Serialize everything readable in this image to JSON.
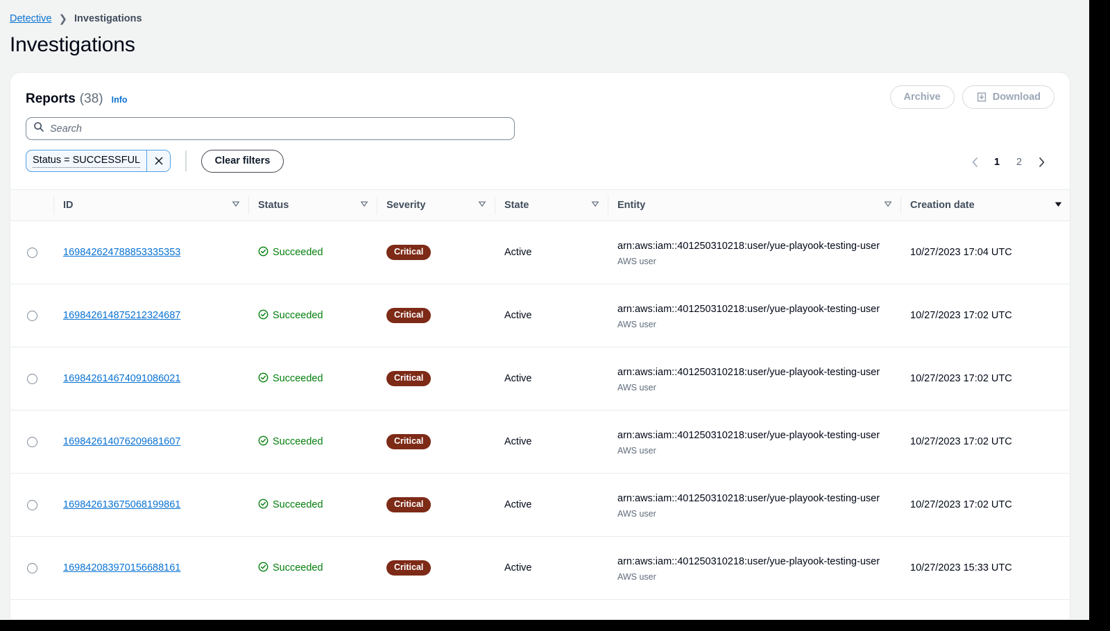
{
  "breadcrumb": {
    "root": "Detective",
    "separator": "❯",
    "current": "Investigations"
  },
  "page_title": "Investigations",
  "panel": {
    "title": "Reports",
    "count": "(38)",
    "info_link": "Info",
    "actions": {
      "archive_label": "Archive",
      "download_label": "Download",
      "download_icon": "download-icon",
      "archive_disabled": true,
      "download_disabled": true
    }
  },
  "search": {
    "placeholder": "Search",
    "value": "",
    "icon": "search-icon"
  },
  "filters": {
    "tokens": [
      {
        "label": "Status = SUCCESSFUL",
        "remove_icon": "close-icon"
      }
    ],
    "clear_label": "Clear filters"
  },
  "pagination": {
    "prev_icon": "chevron-left-icon",
    "next_icon": "chevron-right-icon",
    "pages": [
      "1",
      "2"
    ],
    "current_page": "1",
    "prev_disabled": true,
    "next_disabled": false
  },
  "table": {
    "columns": [
      {
        "label": "ID",
        "sort": "none"
      },
      {
        "label": "Status",
        "sort": "none"
      },
      {
        "label": "Severity",
        "sort": "none"
      },
      {
        "label": "State",
        "sort": "none"
      },
      {
        "label": "Entity",
        "sort": "none"
      },
      {
        "label": "Creation date",
        "sort": "desc"
      }
    ],
    "rows": [
      {
        "id": "169842624788853335353",
        "status": "Succeeded",
        "status_icon": "check-circle-icon",
        "severity": "Critical",
        "state": "Active",
        "entity": "arn:aws:iam::401250310218:user/yue-playook-testing-user",
        "entity_type": "AWS user",
        "creation_date": "10/27/2023 17:04 UTC",
        "selected": false
      },
      {
        "id": "169842614875212324687",
        "status": "Succeeded",
        "status_icon": "check-circle-icon",
        "severity": "Critical",
        "state": "Active",
        "entity": "arn:aws:iam::401250310218:user/yue-playook-testing-user",
        "entity_type": "AWS user",
        "creation_date": "10/27/2023 17:02 UTC",
        "selected": false
      },
      {
        "id": "169842614674091086021",
        "status": "Succeeded",
        "status_icon": "check-circle-icon",
        "severity": "Critical",
        "state": "Active",
        "entity": "arn:aws:iam::401250310218:user/yue-playook-testing-user",
        "entity_type": "AWS user",
        "creation_date": "10/27/2023 17:02 UTC",
        "selected": false
      },
      {
        "id": "169842614076209681607",
        "status": "Succeeded",
        "status_icon": "check-circle-icon",
        "severity": "Critical",
        "state": "Active",
        "entity": "arn:aws:iam::401250310218:user/yue-playook-testing-user",
        "entity_type": "AWS user",
        "creation_date": "10/27/2023 17:02 UTC",
        "selected": false
      },
      {
        "id": "169842613675068199861",
        "status": "Succeeded",
        "status_icon": "check-circle-icon",
        "severity": "Critical",
        "state": "Active",
        "entity": "arn:aws:iam::401250310218:user/yue-playook-testing-user",
        "entity_type": "AWS user",
        "creation_date": "10/27/2023 17:02 UTC",
        "selected": false
      },
      {
        "id": "169842083970156688161",
        "status": "Succeeded",
        "status_icon": "check-circle-icon",
        "severity": "Critical",
        "state": "Active",
        "entity": "arn:aws:iam::401250310218:user/yue-playook-testing-user",
        "entity_type": "AWS user",
        "creation_date": "10/27/2023 15:33 UTC",
        "selected": false
      }
    ]
  },
  "colors": {
    "link": "#0972d3",
    "success": "#037f0c",
    "severity_critical_bg": "#7d2a17",
    "page_bg": "#f2f3f3",
    "card_bg": "#ffffff",
    "border": "#e9ebed",
    "filter_border": "#539fe5",
    "filter_bg": "#f2f8fd"
  }
}
